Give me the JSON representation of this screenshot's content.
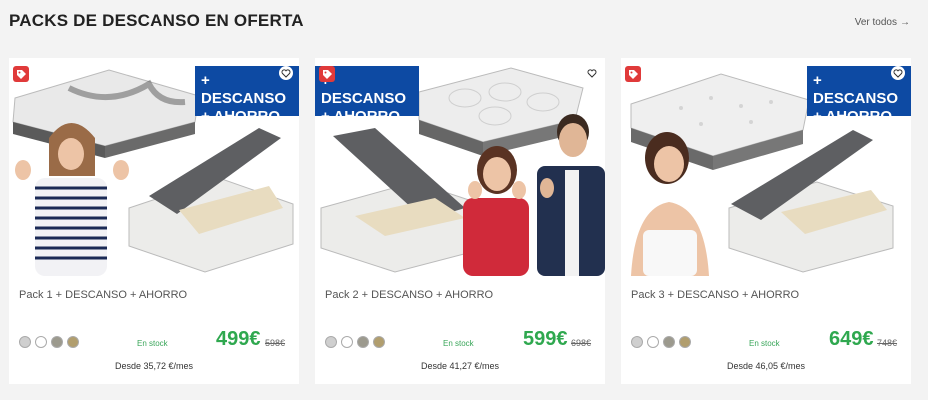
{
  "section": {
    "title": "PACKS DE DESCANSO EN OFERTA",
    "see_all": "Ver todos",
    "see_all_arrow": "→"
  },
  "colors": {
    "price_green": "#2fa84f",
    "promo_blue": "#0d4aa3",
    "tag_red": "#e03a3a"
  },
  "products": [
    {
      "promo_line1": "+ DESCANSO",
      "promo_line2": "+ AHORRO",
      "name": "Pack 1 + DESCANSO + AHORRO",
      "stock": "En stock",
      "price": "499€",
      "old_price": "598€",
      "monthly": "Desde 35,72 €/mes",
      "swatches": [
        "#cfcfcf",
        "#ffffff",
        "#9c9a8e",
        "#b19e6e"
      ]
    },
    {
      "promo_line1": "+ DESCANSO",
      "promo_line2": "+ AHORRO",
      "name": "Pack 2 + DESCANSO + AHORRO",
      "stock": "En stock",
      "price": "599€",
      "old_price": "698€",
      "monthly": "Desde 41,27 €/mes",
      "swatches": [
        "#cfcfcf",
        "#ffffff",
        "#9c9a8e",
        "#b19e6e"
      ]
    },
    {
      "promo_line1": "+ DESCANSO",
      "promo_line2": "+ AHORRO",
      "name": "Pack 3 + DESCANSO + AHORRO",
      "stock": "En stock",
      "price": "649€",
      "old_price": "748€",
      "monthly": "Desde 46,05 €/mes",
      "swatches": [
        "#cfcfcf",
        "#ffffff",
        "#9c9a8e",
        "#b19e6e"
      ]
    }
  ]
}
